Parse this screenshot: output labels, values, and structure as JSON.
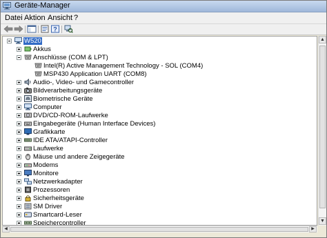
{
  "window": {
    "title": "Geräte-Manager",
    "icon": "computer-manager-icon"
  },
  "menu": [
    "Datei",
    "Aktion",
    "Ansicht",
    "?"
  ],
  "toolbar": [
    {
      "name": "back-button",
      "icon": "arrow-left-icon"
    },
    {
      "name": "forward-button",
      "icon": "arrow-right-icon"
    },
    {
      "name": "show-hide-tree-button",
      "icon": "tree-view-icon"
    },
    {
      "name": "properties-button",
      "icon": "properties-icon"
    },
    {
      "name": "help-button",
      "icon": "help-icon"
    },
    {
      "name": "scan-hardware-button",
      "icon": "scan-hardware-icon"
    }
  ],
  "tree": {
    "root": "W520",
    "children": [
      {
        "label": "Akkus",
        "icon": "battery-icon",
        "expanded": false
      },
      {
        "label": "Anschlüsse (COM & LPT)",
        "icon": "port-icon",
        "expanded": true,
        "children": [
          {
            "label": "Intel(R) Active Management Technology - SOL (COM4)",
            "icon": "port-icon"
          },
          {
            "label": "MSP430 Application UART (COM8)",
            "icon": "port-icon"
          }
        ]
      },
      {
        "label": "Audio-, Video- und Gamecontroller",
        "icon": "speaker-icon",
        "expanded": false
      },
      {
        "label": "Bildverarbeitungsgeräte",
        "icon": "camera-icon",
        "expanded": false
      },
      {
        "label": "Biometrische Geräte",
        "icon": "fingerprint-icon",
        "expanded": false
      },
      {
        "label": "Computer",
        "icon": "computer-icon",
        "expanded": false
      },
      {
        "label": "DVD/CD-ROM-Laufwerke",
        "icon": "disc-drive-icon",
        "expanded": false
      },
      {
        "label": "Eingabegeräte (Human Interface Devices)",
        "icon": "hid-icon",
        "expanded": false
      },
      {
        "label": "Grafikkarte",
        "icon": "display-adapter-icon",
        "expanded": false
      },
      {
        "label": "IDE ATA/ATAPI-Controller",
        "icon": "ide-controller-icon",
        "expanded": false
      },
      {
        "label": "Laufwerke",
        "icon": "hard-drive-icon",
        "expanded": false
      },
      {
        "label": "Mäuse und andere Zeigegeräte",
        "icon": "mouse-icon",
        "expanded": false
      },
      {
        "label": "Modems",
        "icon": "modem-icon",
        "expanded": false
      },
      {
        "label": "Monitore",
        "icon": "monitor-icon",
        "expanded": false
      },
      {
        "label": "Netzwerkadapter",
        "icon": "network-adapter-icon",
        "expanded": false
      },
      {
        "label": "Prozessoren",
        "icon": "processor-icon",
        "expanded": false
      },
      {
        "label": "Sicherheitsgeräte",
        "icon": "security-device-icon",
        "expanded": false
      },
      {
        "label": "SM Driver",
        "icon": "sm-driver-icon",
        "expanded": false
      },
      {
        "label": "Smartcard-Leser",
        "icon": "smartcard-reader-icon",
        "expanded": false
      },
      {
        "label": "Speichercontroller",
        "icon": "storage-controller-icon",
        "expanded": false
      }
    ]
  },
  "colors": {
    "selection": "#316ac5",
    "window_bg": "#ece9d8",
    "tree_bg": "#ffffff"
  }
}
